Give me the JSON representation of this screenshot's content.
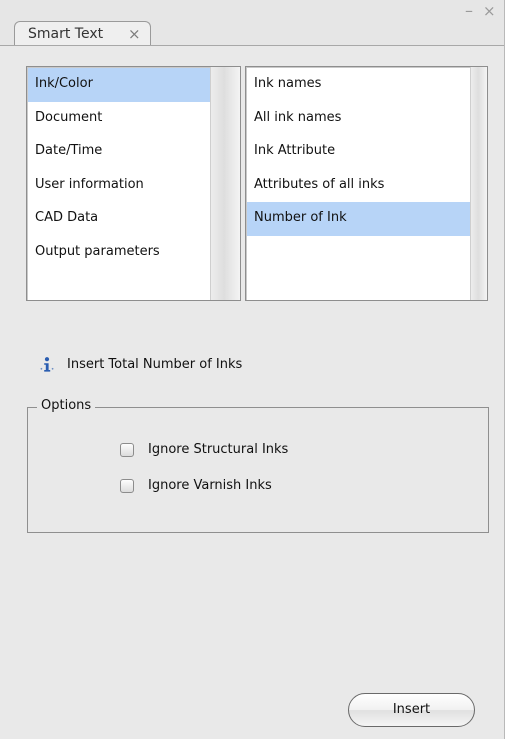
{
  "window": {
    "tab_label": "Smart Text",
    "tab_close_glyph": "×",
    "minimize_glyph": "–",
    "close_glyph": "×"
  },
  "categories": {
    "items": [
      {
        "label": "Ink/Color",
        "selected": true
      },
      {
        "label": "Document",
        "selected": false
      },
      {
        "label": "Date/Time",
        "selected": false
      },
      {
        "label": "User information",
        "selected": false
      },
      {
        "label": "CAD Data",
        "selected": false
      },
      {
        "label": "Output parameters",
        "selected": false
      }
    ]
  },
  "fields": {
    "items": [
      {
        "label": "Ink names",
        "selected": false
      },
      {
        "label": "All ink names",
        "selected": false
      },
      {
        "label": "Ink Attribute",
        "selected": false
      },
      {
        "label": "Attributes of all inks",
        "selected": false
      },
      {
        "label": "Number of Ink",
        "selected": true
      }
    ]
  },
  "info": {
    "icon": "info-icon",
    "text": "Insert Total Number of Inks"
  },
  "options": {
    "legend": "Options",
    "checkboxes": [
      {
        "label": "Ignore Structural Inks",
        "checked": false
      },
      {
        "label": "Ignore Varnish Inks",
        "checked": false
      }
    ]
  },
  "actions": {
    "insert_label": "Insert"
  },
  "colors": {
    "selection": "#b7d4f7",
    "panel": "#e9e9e9",
    "info_icon": "#2a5db0"
  }
}
